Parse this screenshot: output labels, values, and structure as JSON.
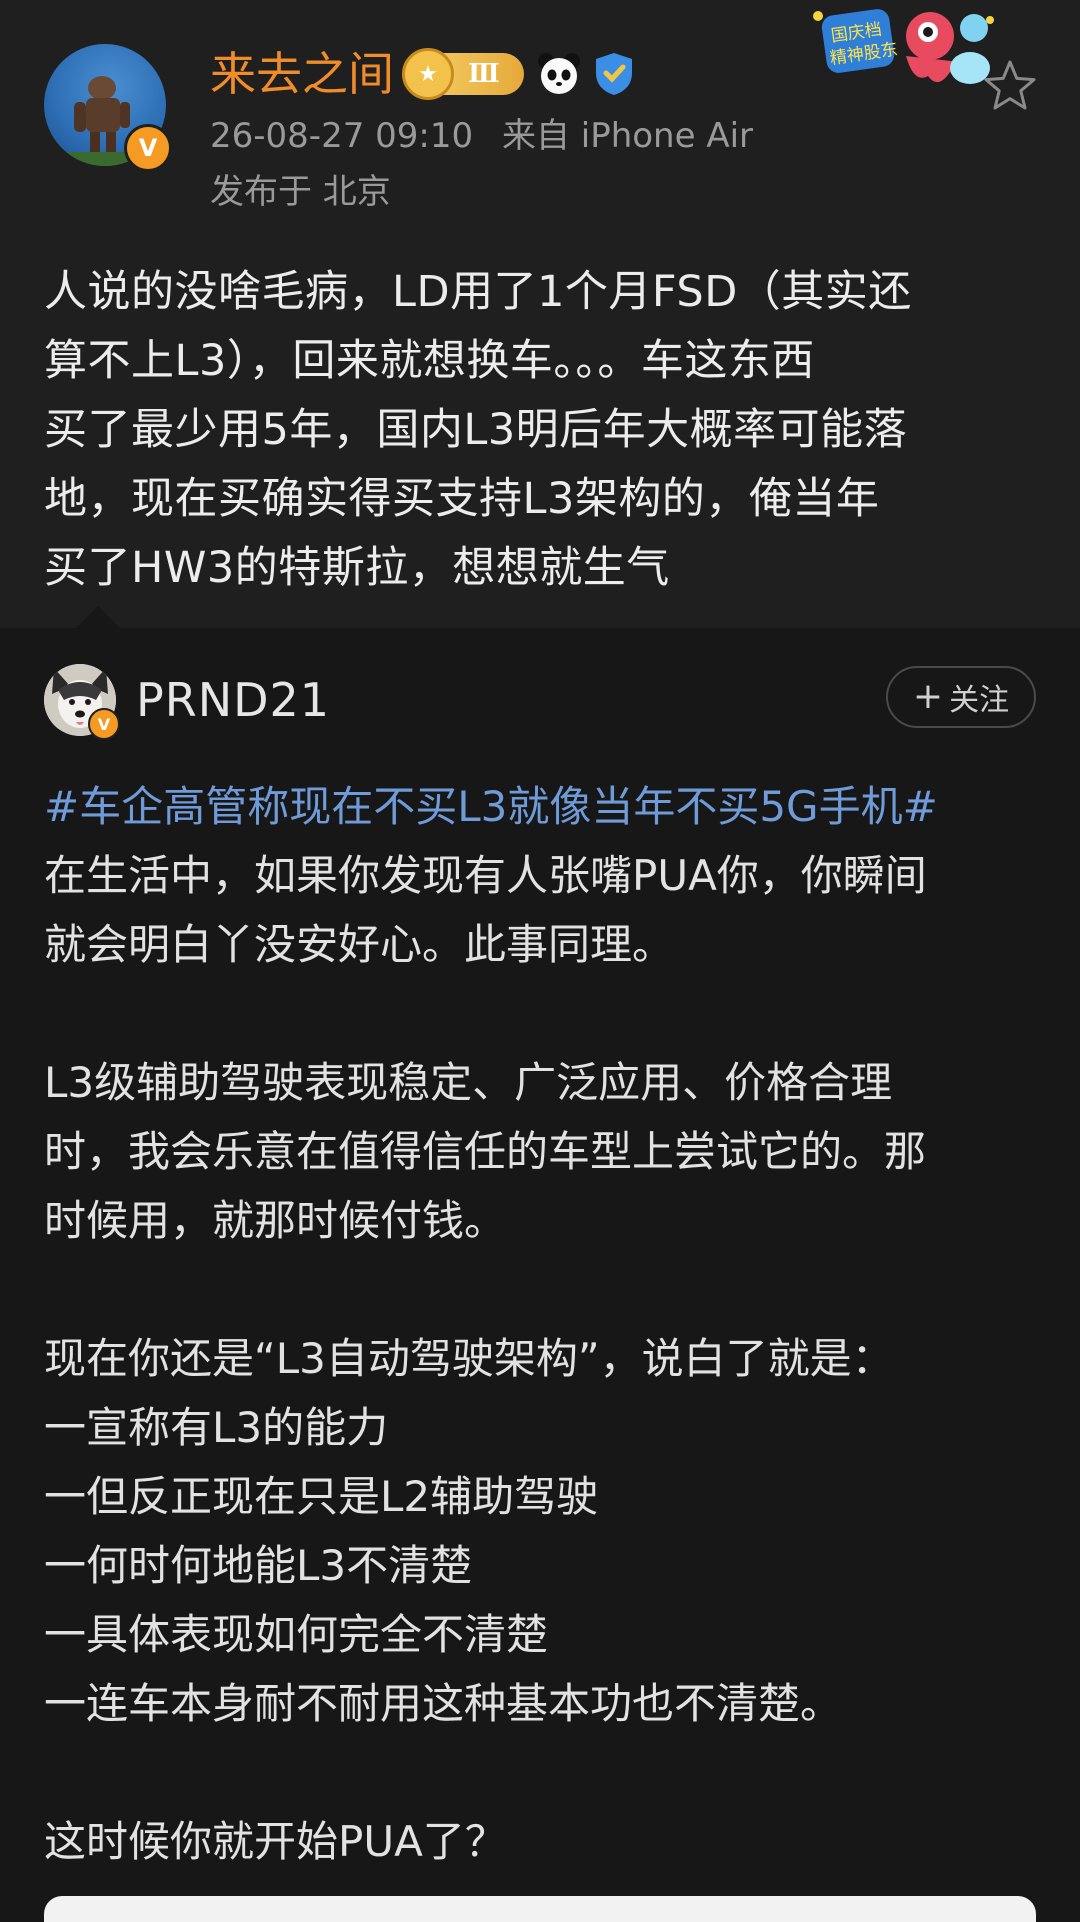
{
  "post": {
    "author_name": "来去之间",
    "level_label": "Ⅲ",
    "timestamp": "26-08-27 09:10",
    "source": "来自 iPhone Air",
    "location": "发布于 北京",
    "lines": [
      "人说的没啥毛病，LD用了1个月FSD（其实还",
      "算不上L3），回来就想换车。。。车这东西",
      "买了最少用5年，国内L3明后年大概率可能落",
      "地，现在买确实得买支持L3架构的，俺当年",
      "买了HW3的特斯拉，想想就生气"
    ],
    "promo_lines": [
      "国庆档",
      "精神股东"
    ]
  },
  "repost": {
    "author_name": "PRND21",
    "follow_label": "关注",
    "hashtag": "#车企高管称现在不买L3就像当年不买5G手机#",
    "para1": [
      "在生活中，如果你发现有人张嘴PUA你，你瞬间",
      "就会明白丫没安好心。此事同理。"
    ],
    "para2": [
      "L3级辅助驾驶表现稳定、广泛应用、价格合理",
      "时，我会乐意在值得信任的车型上尝试它的。那",
      "时候用，就那时候付钱。"
    ],
    "para3": [
      "现在你还是“L3自动驾驶架构”，说白了就是：",
      "一宣称有L3的能力",
      "一但反正现在只是L2辅助驾驶",
      "一何时何地能L3不清楚",
      "一具体表现如何完全不清楚",
      "一连车本身耐不耐用这种基本功也不清楚。"
    ],
    "para4": [
      "这时候你就开始PUA了？"
    ]
  },
  "colors": {
    "background": "#1f1f1f",
    "repost_background": "#171717",
    "author_orange": "#f08c2a",
    "hashtag_blue": "#6f9bd8",
    "meta_gray": "#9a9a9a",
    "verified_badge": "#f59a23"
  },
  "icons": {
    "verified": "verified-v-icon",
    "level": "crown-level-icon",
    "panda": "panda-icon",
    "shield": "shield-icon",
    "favorite": "star-outline-icon",
    "follow": "plus-icon"
  }
}
